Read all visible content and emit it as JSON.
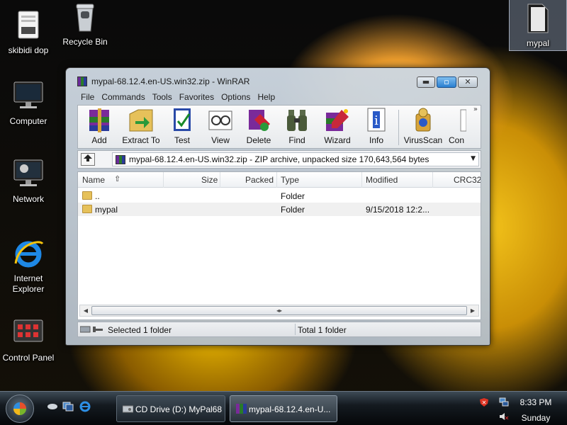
{
  "desktop": {
    "icons": [
      {
        "label": "skibidi dop"
      },
      {
        "label": "Recycle Bin"
      },
      {
        "label": "Computer"
      },
      {
        "label": "Network"
      },
      {
        "label": "Internet Explorer"
      },
      {
        "label": "Control Panel"
      },
      {
        "label": "mypal"
      }
    ]
  },
  "window": {
    "title": "mypal-68.12.4.en-US.win32.zip - WinRAR",
    "menu": [
      "File",
      "Commands",
      "Tools",
      "Favorites",
      "Options",
      "Help"
    ],
    "toolbar": [
      "Add",
      "Extract To",
      "Test",
      "View",
      "Delete",
      "Find",
      "Wizard",
      "Info",
      "VirusScan",
      "Con"
    ],
    "address": "mypal-68.12.4.en-US.win32.zip - ZIP archive, unpacked size 170,643,564 bytes",
    "columns": [
      "Name",
      "Size",
      "Packed",
      "Type",
      "Modified",
      "CRC32"
    ],
    "rows": [
      {
        "name": "..",
        "size": "",
        "packed": "",
        "type": "Folder",
        "modified": ""
      },
      {
        "name": "mypal",
        "size": "",
        "packed": "",
        "type": "Folder",
        "modified": "9/15/2018 12:2..."
      }
    ],
    "status_left": "Selected 1 folder",
    "status_right": "Total 1 folder"
  },
  "taskbar": {
    "buttons": [
      {
        "label": "CD Drive (D:) MyPal68"
      },
      {
        "label": "mypal-68.12.4.en-U..."
      }
    ],
    "clock_time": "8:33 PM",
    "clock_day": "Sunday"
  },
  "colors": {
    "accent": "#2a7fd0",
    "folder": "#e6c15a"
  }
}
